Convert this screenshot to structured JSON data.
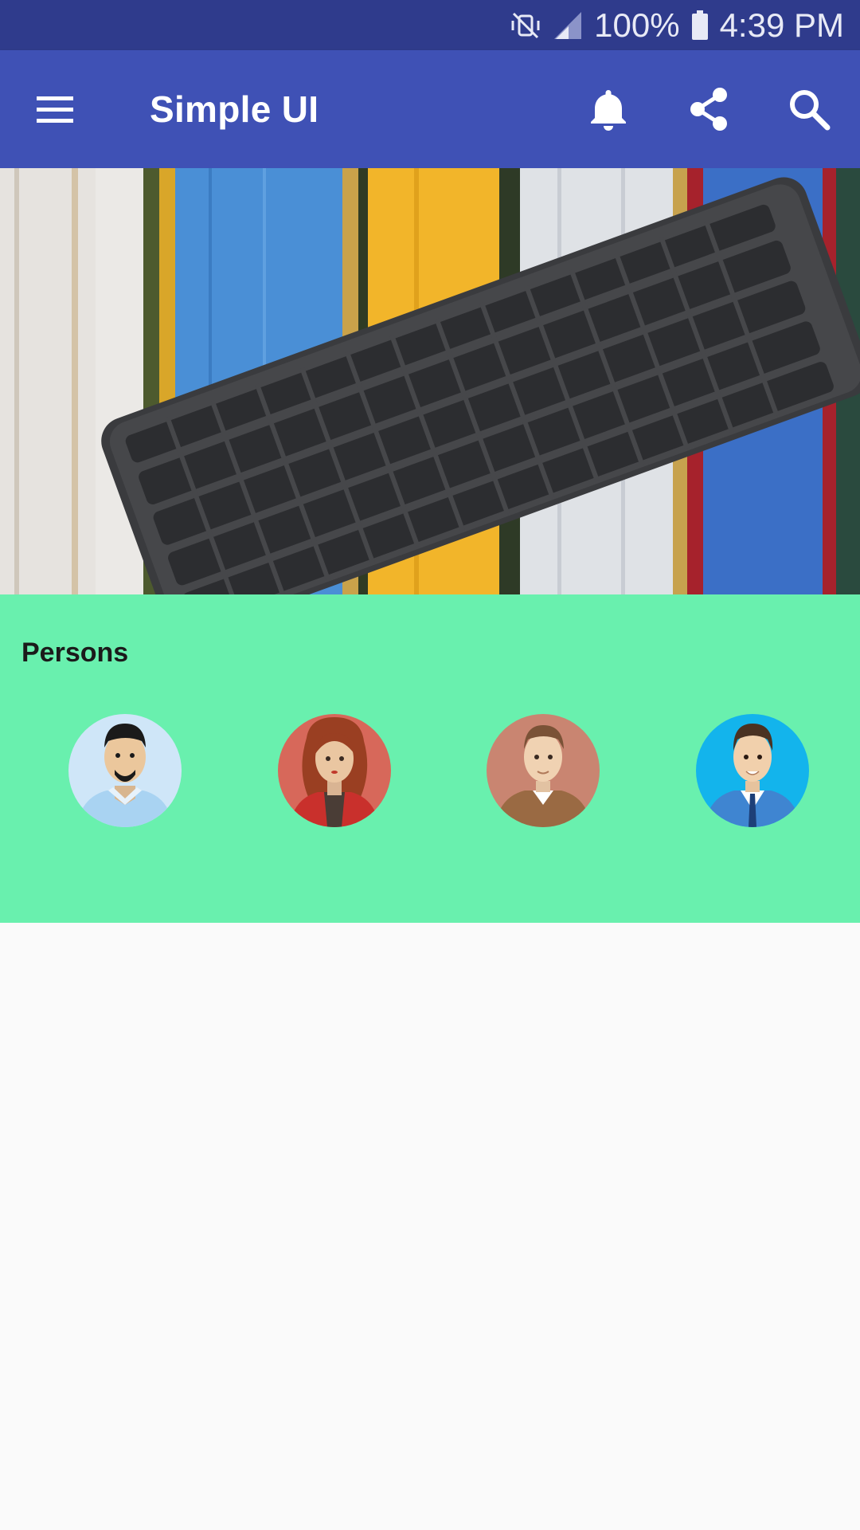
{
  "status_bar": {
    "battery": "100%",
    "time": "4:39 PM",
    "icons": [
      "vibrate-mute-icon",
      "signal-icon",
      "battery-icon"
    ]
  },
  "app_bar": {
    "title": "Simple UI",
    "background": "#3f51b5",
    "actions": [
      "menu-icon",
      "bell-icon",
      "share-icon",
      "search-icon"
    ]
  },
  "hero": {
    "image": "keyboard-on-colorful-books"
  },
  "persons": {
    "heading": "Persons",
    "background": "#69f0ae",
    "avatars": [
      "avatar-man-goatee",
      "avatar-woman-red-hair",
      "avatar-man-brown-suit",
      "avatar-man-blue-suit"
    ]
  }
}
